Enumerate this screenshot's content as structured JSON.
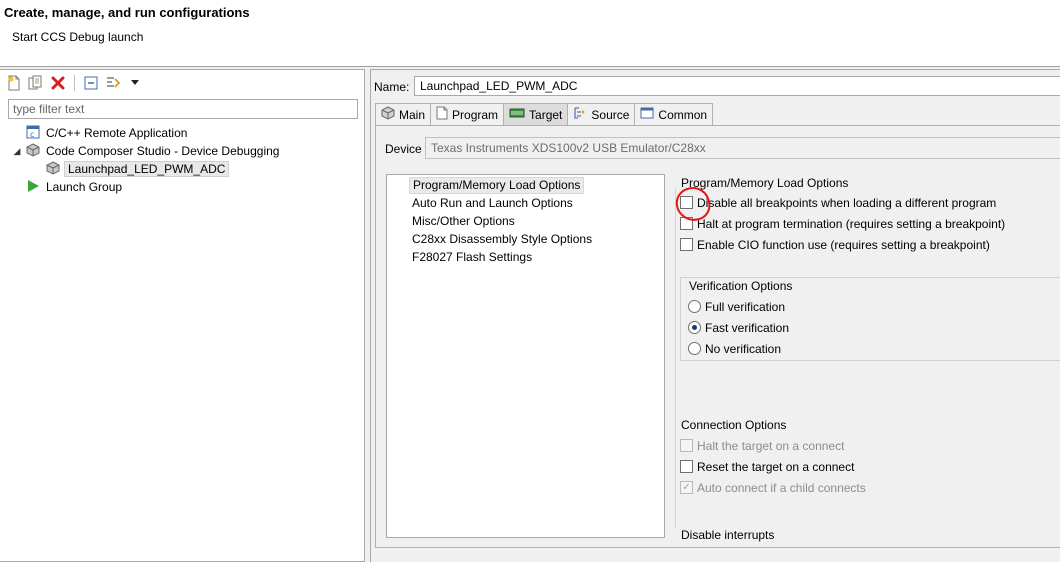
{
  "header": {
    "title": "Create, manage, and run configurations",
    "subtitle": "Start CCS Debug launch"
  },
  "left": {
    "toolbar_icons": [
      "new-config-icon",
      "duplicate-icon",
      "delete-icon",
      "collapse-all-icon",
      "filter-icon",
      "dropdown-arrow-icon"
    ],
    "filter_placeholder": "type filter text",
    "tree": [
      {
        "label": "C/C++ Remote Application",
        "icon": "c-app-icon"
      },
      {
        "label": "Code Composer Studio - Device Debugging",
        "icon": "ccs-cube-icon",
        "expanded": true
      },
      {
        "label": "Launchpad_LED_PWM_ADC",
        "icon": "ccs-cube-icon",
        "selected": true
      },
      {
        "label": "Launch Group",
        "icon": "play-icon"
      }
    ]
  },
  "right": {
    "name_label": "Name:",
    "name_value": "Launchpad_LED_PWM_ADC",
    "tabs": [
      {
        "label": "Main",
        "icon": "cube-icon"
      },
      {
        "label": "Program",
        "icon": "page-icon"
      },
      {
        "label": "Target",
        "icon": "chip-icon",
        "active": true
      },
      {
        "label": "Source",
        "icon": "source-icon"
      },
      {
        "label": "Common",
        "icon": "window-icon"
      }
    ],
    "device_label": "Device",
    "device_value": "Texas Instruments XDS100v2 USB Emulator/C28xx",
    "categories": [
      "Program/Memory Load Options",
      "Auto Run and Launch Options",
      "Misc/Other Options",
      "C28xx Disassembly Style Options",
      "F28027 Flash Settings"
    ],
    "load_options": {
      "title": "Program/Memory Load Options",
      "items": [
        {
          "label": "Disable all breakpoints when loading a different program",
          "checked": false
        },
        {
          "label": "Halt at program termination (requires setting a breakpoint)",
          "checked": false
        },
        {
          "label": "Enable CIO function use (requires setting a breakpoint)",
          "checked": false
        }
      ]
    },
    "verification": {
      "title": "Verification Options",
      "options": [
        "Full verification",
        "Fast verification",
        "No verification"
      ],
      "selected": "Fast verification"
    },
    "connection": {
      "title": "Connection Options",
      "items": [
        {
          "label": "Halt the target on a connect",
          "checked": false,
          "disabled": true
        },
        {
          "label": "Reset the target on a connect",
          "checked": false,
          "disabled": false
        },
        {
          "label": "Auto connect if a child connects",
          "checked": true,
          "disabled": true
        }
      ]
    },
    "interrupts_title": "Disable interrupts"
  },
  "colors": {
    "annotation": "#e01818",
    "radio_dot": "#1a3a70"
  }
}
